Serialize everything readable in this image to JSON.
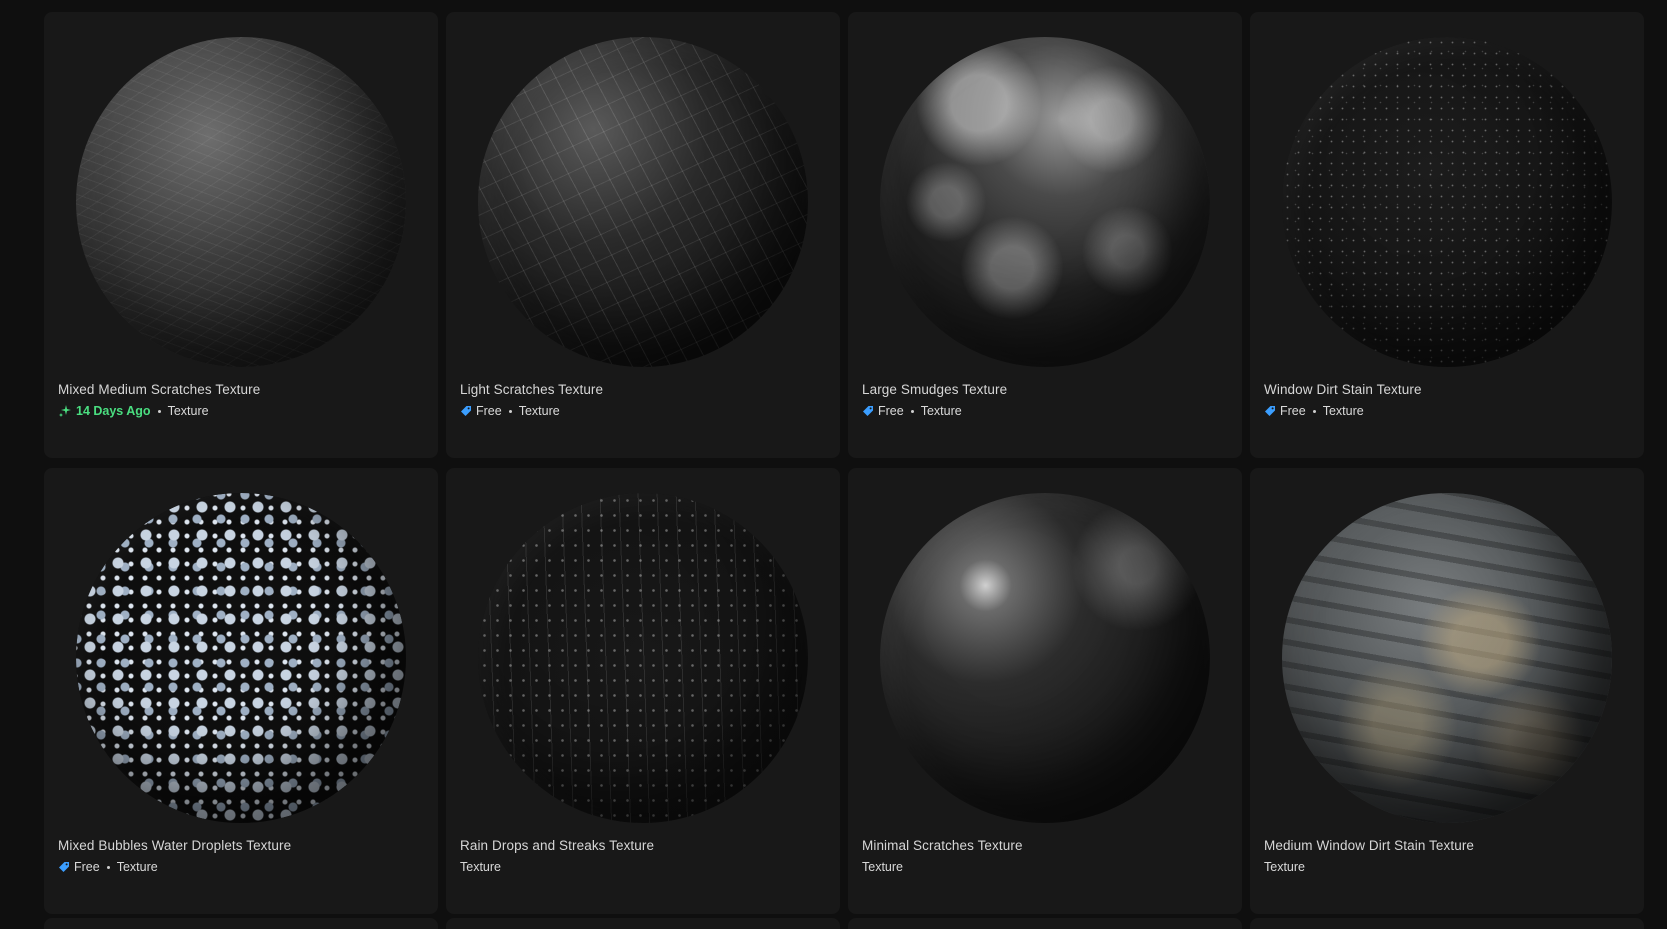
{
  "cards": [
    {
      "title": "Mixed Medium Scratches Texture",
      "badge": "14 Days Ago",
      "badge_type": "new",
      "category": "Texture"
    },
    {
      "title": "Light Scratches Texture",
      "badge": "Free",
      "badge_type": "free",
      "category": "Texture"
    },
    {
      "title": "Large Smudges Texture",
      "badge": "Free",
      "badge_type": "free",
      "category": "Texture"
    },
    {
      "title": "Window Dirt Stain Texture",
      "badge": "Free",
      "badge_type": "free",
      "category": "Texture"
    },
    {
      "title": "Mixed Bubbles Water Droplets Texture",
      "badge": "Free",
      "badge_type": "free",
      "category": "Texture"
    },
    {
      "title": "Rain Drops and Streaks Texture",
      "badge": "",
      "badge_type": "none",
      "category": "Texture"
    },
    {
      "title": "Minimal Scratches Texture",
      "badge": "",
      "badge_type": "none",
      "category": "Texture"
    },
    {
      "title": "Medium Window Dirt Stain Texture",
      "badge": "",
      "badge_type": "none",
      "category": "Texture"
    }
  ],
  "colors": {
    "free_tag": "#3b9eff",
    "new_badge": "#4ade80",
    "card_bg": "#181818",
    "page_bg": "#0f0f0f"
  }
}
